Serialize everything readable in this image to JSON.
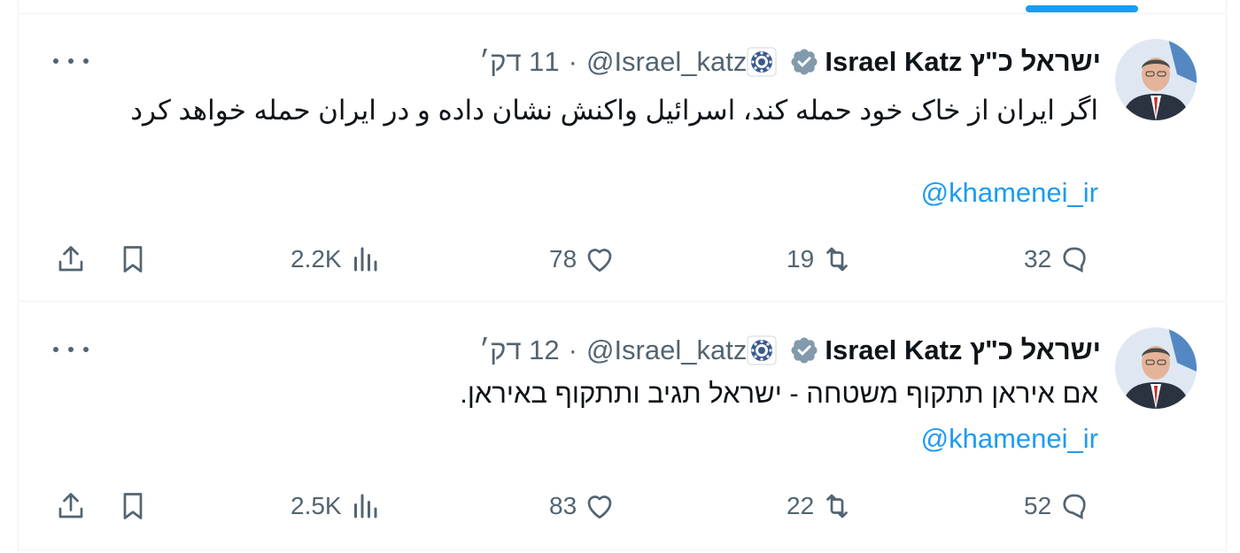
{
  "tweets": [
    {
      "name": "ישראל כ\"ץ Israel Katz",
      "handle": "@Israel_katz",
      "separator": "·",
      "time": "11 דק׳",
      "text": "اگر ایران از خاک خود حمله کند، اسرائیل واکنش نشان داده و در ایران حمله خواهد کرد",
      "mention": "@khamenei_ir",
      "replies": "32",
      "retweets": "19",
      "likes": "78",
      "views": "2.2K"
    },
    {
      "name": "ישראל כ\"ץ Israel Katz",
      "handle": "@Israel_katz",
      "separator": "·",
      "time": "12 דק׳",
      "text": "אם איראן תתקוף משטחה - ישראל תגיב ותתקוף באיראן.",
      "mention": "@khamenei_ir",
      "replies": "52",
      "retweets": "22",
      "likes": "83",
      "views": "2.5K"
    }
  ],
  "colors": {
    "accent": "#1d9bf0",
    "secondary_text": "#536471",
    "primary_text": "#0f1419",
    "verified_gray": "#829aab",
    "divider": "#eff3f4"
  },
  "icons": {
    "reply": "reply-icon",
    "retweet": "retweet-icon",
    "like": "heart-icon",
    "views": "views-icon",
    "bookmark": "bookmark-icon",
    "share": "share-icon",
    "more": "more-icon",
    "verified": "verified-badge-icon",
    "org": "government-badge-icon"
  }
}
